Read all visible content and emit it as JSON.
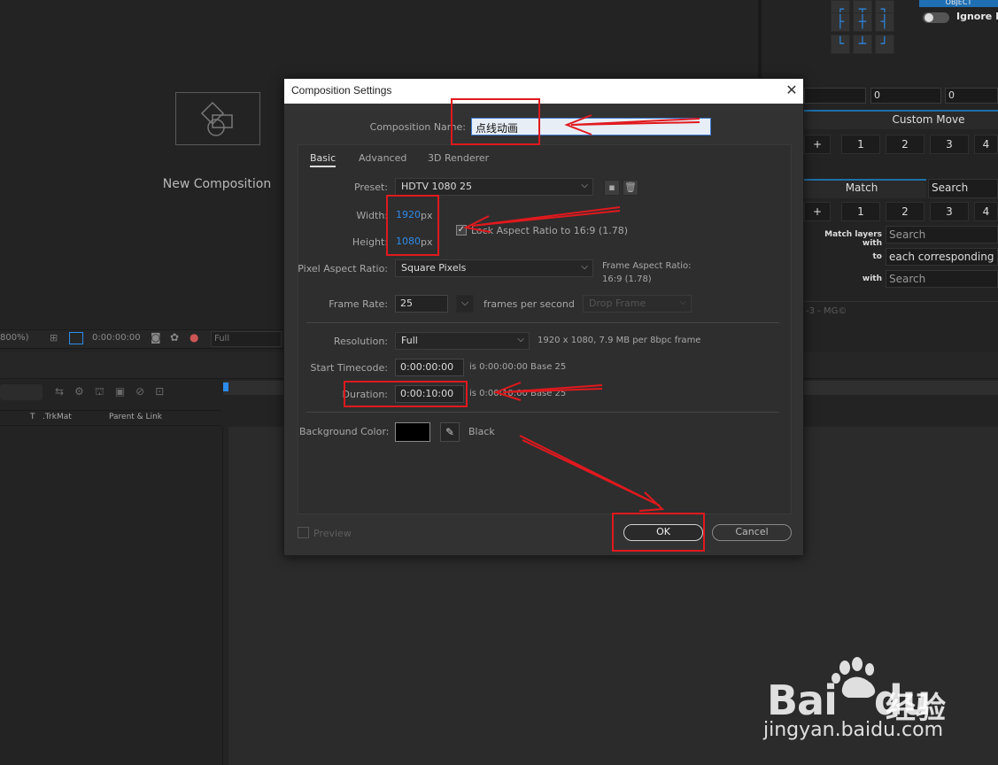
{
  "app": {
    "new_composition_label": "New Composition",
    "viewer": {
      "zoom": "800%)",
      "timecode": "0:00:00:00",
      "resolution": "Full"
    },
    "timeline_columns": {
      "t": "T",
      "trkmat": ".TrkMat",
      "parent": "Parent & Link"
    }
  },
  "right_panel": {
    "object_button": "OBJECT",
    "ignore_label": "Ignore M",
    "numeric_fields": [
      "0",
      "0"
    ],
    "custom_move_title": "Custom Move",
    "custom_move_buttons": [
      "+",
      "1",
      "2",
      "3",
      "4"
    ],
    "match_tab": "Match",
    "search_tab": "Search",
    "match_buttons": [
      "+",
      "1",
      "2",
      "3",
      "4"
    ],
    "match_layers_with_label": "Match layers with",
    "match_layers_with_value": "Search",
    "to_label": "to",
    "to_value": "each corresponding lay",
    "with_label": "with",
    "with_value": "Search",
    "footer": "-3 - MG©"
  },
  "dialog": {
    "title": "Composition Settings",
    "name_label": "Composition Name:",
    "name_value": "点线动画",
    "tabs": [
      "Basic",
      "Advanced",
      "3D Renderer"
    ],
    "preset_label": "Preset:",
    "preset_value": "HDTV 1080 25",
    "width_label": "Width:",
    "width_value": "1920",
    "height_label": "Height:",
    "height_value": "1080",
    "px_unit": "px",
    "lock_aspect_label": "Lock Aspect Ratio to 16:9 (1.78)",
    "lock_aspect_checked": true,
    "par_label": "Pixel Aspect Ratio:",
    "par_value": "Square Pixels",
    "frame_aspect_label": "Frame Aspect Ratio:",
    "frame_aspect_value": "16:9 (1.78)",
    "frame_rate_label": "Frame Rate:",
    "frame_rate_value": "25",
    "fps_label": "frames per second",
    "drop_frame_value": "Drop Frame",
    "resolution_label": "Resolution:",
    "resolution_value": "Full",
    "resolution_info": "1920 x 1080, 7.9 MB per 8bpc frame",
    "start_tc_label": "Start Timecode:",
    "start_tc_value": "0:00:00:00",
    "start_tc_info": "is 0:00:00:00  Base 25",
    "duration_label": "Duration:",
    "duration_value": "0:00:10:00",
    "duration_info": "is 0:00:10:00  Base 25",
    "bg_color_label": "Background Color:",
    "bg_color_name": "Black",
    "bg_color": "#000000",
    "preview_label": "Preview",
    "ok_label": "OK",
    "cancel_label": "Cancel"
  },
  "colors": {
    "accent_blue": "#2d8ceb",
    "annotation_red": "#e0191e",
    "dialog_bg": "#323232"
  },
  "watermark": {
    "brand": "Bai",
    "brand_du": "du",
    "brand_cn": "经验",
    "url": "jingyan.baidu.com"
  }
}
